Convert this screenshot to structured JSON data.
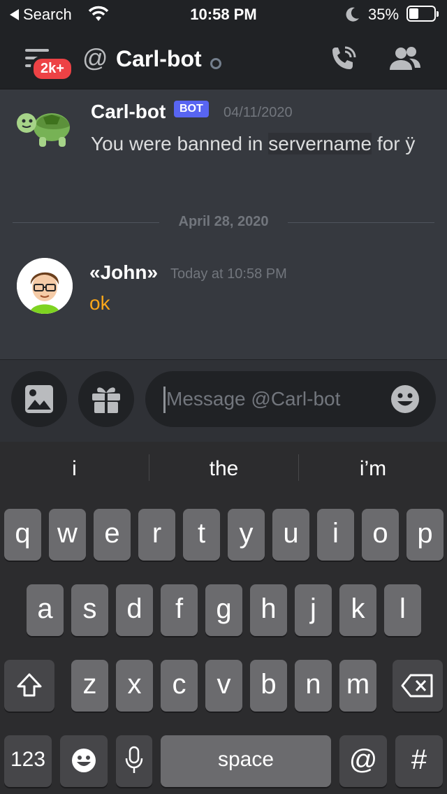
{
  "status_bar": {
    "back_label": "Search",
    "time": "10:58 PM",
    "battery": "35%"
  },
  "header": {
    "badge": "2k+",
    "at_symbol": "@",
    "title": "Carl-bot"
  },
  "messages": [
    {
      "author": "Carl-bot",
      "tag": "BOT",
      "timestamp": "04/11/2020",
      "text_before": "You were banned in ",
      "text_highlight": "servername",
      "text_after": " for ÿ"
    },
    {
      "divider": "April 28, 2020"
    },
    {
      "author": "«John»",
      "timestamp": "Today at 10:58 PM",
      "text": "ok"
    }
  ],
  "composer": {
    "placeholder": "Message @Carl-bot"
  },
  "keyboard": {
    "suggestions": [
      "i",
      "the",
      "i’m"
    ],
    "row1": [
      "q",
      "w",
      "e",
      "r",
      "t",
      "y",
      "u",
      "i",
      "o",
      "p"
    ],
    "row2": [
      "a",
      "s",
      "d",
      "f",
      "g",
      "h",
      "j",
      "k",
      "l"
    ],
    "row3": [
      "z",
      "x",
      "c",
      "v",
      "b",
      "n",
      "m"
    ],
    "numbers_label": "123",
    "space_label": "space",
    "at_label": "@",
    "hash_label": "#"
  },
  "colors": {
    "background": "#36393f",
    "header": "#202225",
    "bot_tag": "#5865f2",
    "badge": "#ed4245",
    "john_text": "#faa61a"
  },
  "icons": [
    "chevron-left-icon",
    "wifi-icon",
    "moon-icon",
    "battery-icon",
    "menu-icon",
    "call-icon",
    "people-icon",
    "turtle-avatar",
    "image-icon",
    "gift-icon",
    "emoji-icon",
    "shift-icon",
    "delete-icon",
    "emoji-key-icon",
    "mic-icon"
  ]
}
